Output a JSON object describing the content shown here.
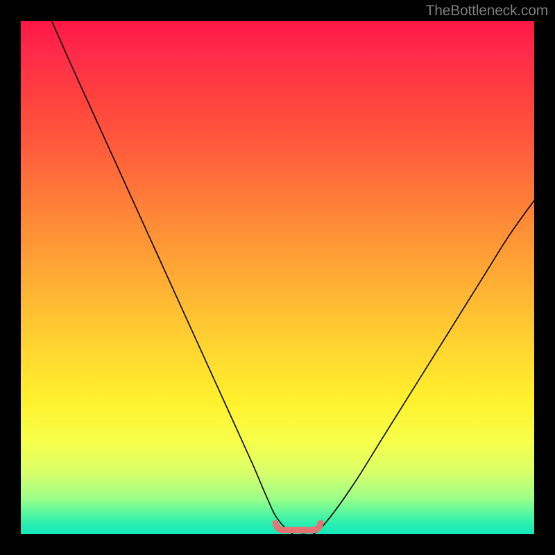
{
  "watermark": "TheBottleneck.com",
  "colors": {
    "frame": "#000000",
    "curve": "#000000",
    "flat_marker": "#e57373",
    "gradient_top": "#ff1744",
    "gradient_bottom": "#15e8bb"
  },
  "chart_data": {
    "type": "line",
    "title": "",
    "xlabel": "",
    "ylabel": "",
    "xlim": [
      0,
      100
    ],
    "ylim": [
      0,
      100
    ],
    "series": [
      {
        "name": "bottleneck-curve",
        "x": [
          6,
          10,
          15,
          20,
          25,
          30,
          35,
          40,
          45,
          48,
          50,
          53,
          55,
          57,
          60,
          65,
          70,
          75,
          80,
          85,
          90,
          95,
          100
        ],
        "y": [
          100,
          91,
          80,
          69,
          58,
          47,
          36,
          25,
          14,
          7,
          3,
          0,
          0,
          0,
          3,
          10,
          18,
          26,
          34,
          42,
          50,
          58,
          65
        ]
      }
    ],
    "annotations": [
      {
        "name": "optimal-flat-region",
        "x_range": [
          50,
          58
        ],
        "y": 0
      }
    ]
  }
}
